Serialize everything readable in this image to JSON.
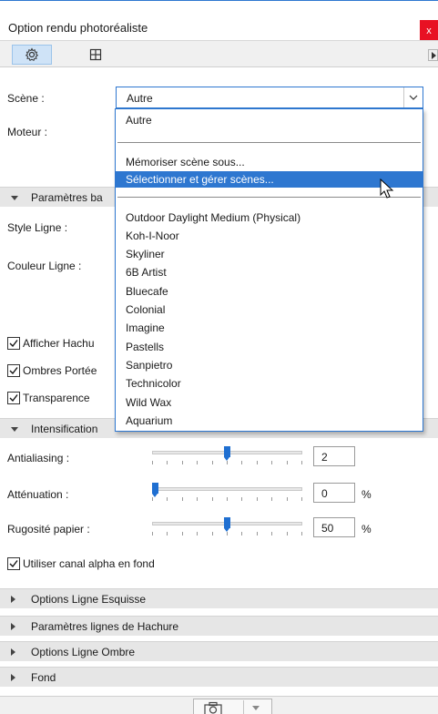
{
  "window": {
    "title": "Option rendu photoréaliste",
    "close_label": "x"
  },
  "toolbar": {
    "tabs": [
      {
        "icon": "gear-icon",
        "active": true
      },
      {
        "icon": "crosshair-frame-icon",
        "active": false
      }
    ]
  },
  "fields": {
    "scene_label": "Scène :",
    "scene_value": "Autre",
    "engine_label": "Moteur :",
    "line_style_label": "Style Ligne :",
    "line_color_label": "Couleur Ligne :"
  },
  "sections": {
    "base_params": "Paramètres ba",
    "intensification": "Intensification",
    "sketch_line_options": "Options Ligne Esquisse",
    "hatch_line_params": "Paramètres lignes de Hachure",
    "shadow_line_options": "Options Ligne Ombre",
    "background": "Fond"
  },
  "checkboxes": {
    "show_hatch": {
      "label": "Afficher Hachu",
      "checked": true
    },
    "cast_shadows": {
      "label": "Ombres Portée",
      "checked": true
    },
    "transparency": {
      "label": "Transparence",
      "checked": true
    },
    "alpha_bg": {
      "label": "Utiliser canal alpha en fond",
      "checked": true
    }
  },
  "sliders": {
    "antialiasing": {
      "label": "Antialiasing :",
      "value": "2",
      "unit": "",
      "level": 0.5
    },
    "attenuation": {
      "label": "Atténuation :",
      "value": "0",
      "unit": "%",
      "level": 0.0
    },
    "paper_roughness": {
      "label": "Rugosité papier :",
      "value": "50",
      "unit": "%",
      "level": 0.5
    }
  },
  "dropdown": {
    "top_item": "Autre",
    "memorize": "Mémoriser scène sous...",
    "select_manage": "Sélectionner et gérer scènes...",
    "scenes": [
      "Outdoor Daylight Medium (Physical)",
      "Koh-I-Noor",
      "Skyliner",
      "6B Artist",
      "Bluecafe",
      "Colonial",
      "Imagine",
      "Pastells",
      "Sanpietro",
      "Technicolor",
      "Wild Wax",
      "Aquarium"
    ]
  },
  "colors": {
    "accent": "#2e77d0",
    "close": "#e81123",
    "section_bg": "#e6e6e6"
  }
}
